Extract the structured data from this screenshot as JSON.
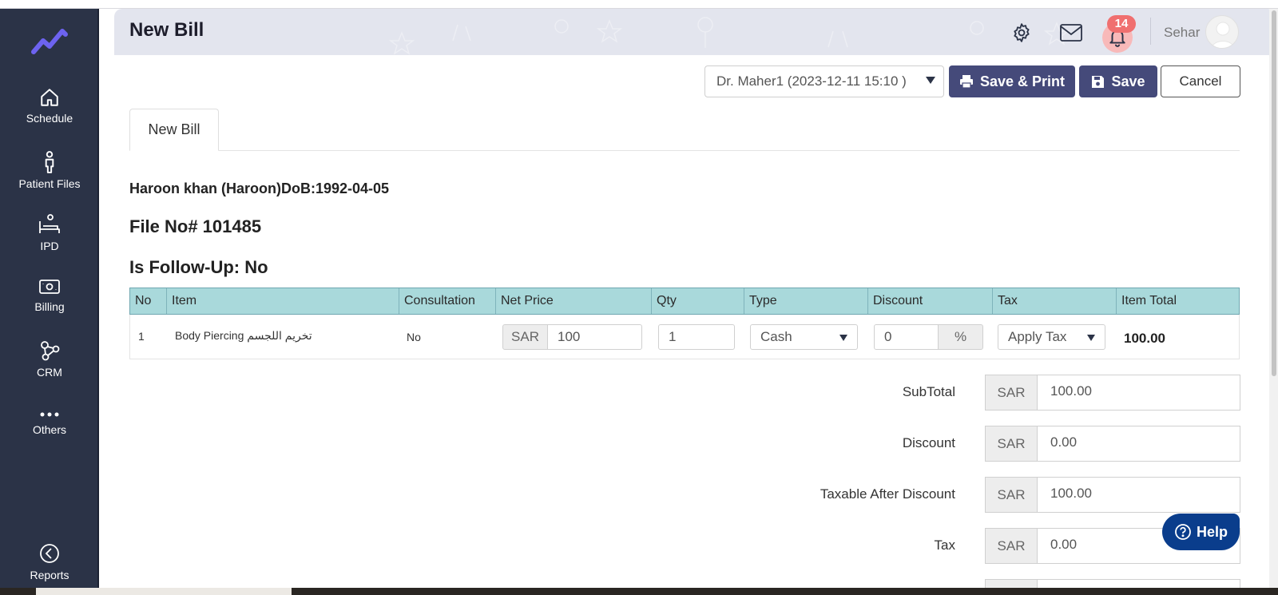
{
  "sidebar": {
    "items": [
      {
        "label": "Schedule",
        "icon": "home-icon"
      },
      {
        "label": "Patient Files",
        "icon": "patient-icon"
      },
      {
        "label": "IPD",
        "icon": "bed-icon"
      },
      {
        "label": "Billing",
        "icon": "money-icon"
      },
      {
        "label": "CRM",
        "icon": "network-icon"
      },
      {
        "label": "Others",
        "icon": "more-icon"
      },
      {
        "label": "Reports",
        "icon": "reports-icon"
      }
    ]
  },
  "header": {
    "title": "New Bill",
    "notification_count": "14",
    "user_name": "Sehar"
  },
  "actions": {
    "doctor_selected": "Dr. Maher1 (2023-12-11 15:10 )",
    "save_print_label": "Save & Print",
    "save_label": "Save",
    "cancel_label": "Cancel"
  },
  "tab": {
    "label": "New Bill"
  },
  "patient": {
    "line": "Haroon khan (Haroon)DoB:1992-04-05",
    "file_no": "File No# 101485",
    "followup": "Is Follow-Up: No"
  },
  "table": {
    "columns": [
      "No",
      "Item",
      "Consultation",
      "Net Price",
      "Qty",
      "Type",
      "Discount",
      "Tax",
      "Item Total"
    ],
    "rows": [
      {
        "no": "1",
        "item": "Body Piercing تخريم اللجسم",
        "consultation": "No",
        "currency": "SAR",
        "net_price": "100",
        "qty": "1",
        "type": "Cash",
        "discount": "0",
        "discount_unit": "%",
        "tax": "Apply Tax",
        "item_total": "100.00"
      }
    ]
  },
  "totals": {
    "currency": "SAR",
    "lines": [
      {
        "label": "SubTotal",
        "value": "100.00"
      },
      {
        "label": "Discount",
        "value": "0.00"
      },
      {
        "label": "Taxable After Discount",
        "value": "100.00"
      },
      {
        "label": "Tax",
        "value": "0.00"
      }
    ]
  },
  "help": {
    "label": "Help"
  },
  "colors": {
    "sidebar_bg": "#2b3347",
    "accent_button": "#454a7a",
    "table_header": "#a9d9db",
    "badge": "#f06f6f",
    "help": "#0a3d8c"
  }
}
